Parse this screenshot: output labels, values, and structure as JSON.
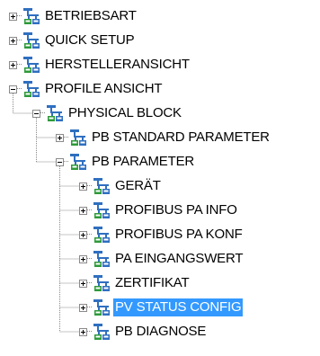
{
  "tree": {
    "nodes": [
      {
        "label": "BETRIEBSART",
        "level": 0,
        "state": "collapsed",
        "selected": false
      },
      {
        "label": "QUICK SETUP",
        "level": 0,
        "state": "collapsed",
        "selected": false
      },
      {
        "label": "HERSTELLERANSICHT",
        "level": 0,
        "state": "collapsed",
        "selected": false
      },
      {
        "label": "PROFILE ANSICHT",
        "level": 0,
        "state": "expanded",
        "selected": false
      },
      {
        "label": "PHYSICAL BLOCK",
        "level": 1,
        "state": "expanded",
        "selected": false
      },
      {
        "label": "PB STANDARD PARAMETER",
        "level": 2,
        "state": "collapsed",
        "selected": false
      },
      {
        "label": "PB PARAMETER",
        "level": 2,
        "state": "expanded",
        "selected": false
      },
      {
        "label": "GERÄT",
        "level": 3,
        "state": "collapsed",
        "selected": false
      },
      {
        "label": "PROFIBUS PA INFO",
        "level": 3,
        "state": "collapsed",
        "selected": false
      },
      {
        "label": "PROFIBUS PA KONF",
        "level": 3,
        "state": "collapsed",
        "selected": false
      },
      {
        "label": "PA EINGANGSWERT",
        "level": 3,
        "state": "collapsed",
        "selected": false
      },
      {
        "label": "ZERTIFIKAT",
        "level": 3,
        "state": "collapsed",
        "selected": false
      },
      {
        "label": "PV STATUS CONFIG",
        "level": 3,
        "state": "collapsed",
        "selected": true
      },
      {
        "label": "PB DIAGNOSE",
        "level": 3,
        "state": "collapsed",
        "selected": false
      }
    ],
    "icon": "device-group-icon",
    "colors": {
      "selection_bg": "#3399ff",
      "selection_text": "#ffffff",
      "text": "#000000",
      "tree_lines": "#8a8a8a",
      "icon_blue": "#2f6fc0",
      "icon_green": "#2e9a3a"
    }
  }
}
